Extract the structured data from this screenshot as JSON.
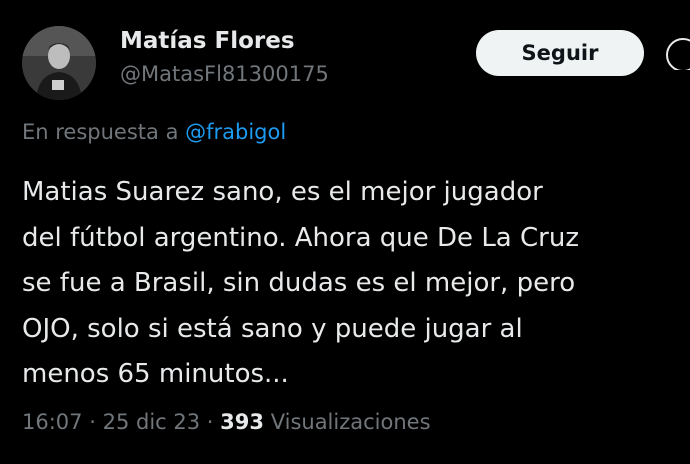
{
  "author": {
    "name": "Matías Flores",
    "handle": "@MatasFl81300175",
    "avatar": "profile-photo"
  },
  "actions": {
    "follow_label": "Seguir",
    "more_icon": "more-options-icon"
  },
  "reply": {
    "prefix": "En respuesta a",
    "mention": "@frabigol"
  },
  "tweet": {
    "lines": [
      "Matias Suarez sano, es el mejor jugador",
      "del fútbol argentino. Ahora que De La Cruz",
      "se fue a Brasil, sin dudas es el mejor, pero",
      "OJO, solo si está sano y puede jugar al",
      "menos 65 minutos..."
    ]
  },
  "meta": {
    "time": "16:07",
    "date": "25 dic 23",
    "separator": "·",
    "views_count": "393",
    "views_label": "Visualizaciones"
  },
  "colors": {
    "background": "#000000",
    "text": "#e7e9ea",
    "secondary": "#71767b",
    "link": "#1d9bf0",
    "button_bg": "#eff3f4"
  }
}
